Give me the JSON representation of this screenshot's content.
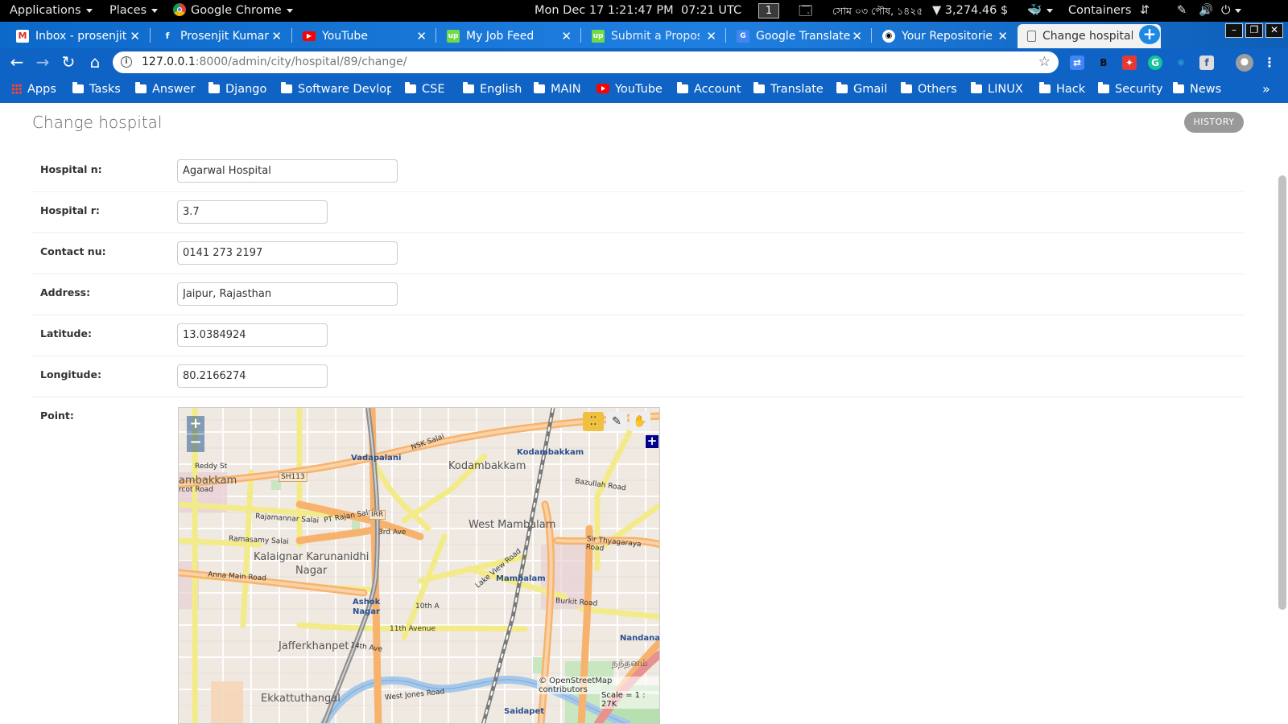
{
  "topbar": {
    "applications": "Applications",
    "places": "Places",
    "chrome": "Google Chrome",
    "datetime": "Mon Dec 17  1:21:47 PM",
    "utc": "07:21 UTC",
    "workspace": "1",
    "bengali_date": "সোম ০৩ পৌষ, ১৪২৫",
    "price": "▼ 3,274.46 $",
    "containers": "Containers"
  },
  "tabs": [
    {
      "label": "Inbox - prosenjit",
      "icon": "gmail-icon",
      "color": "#ffffff"
    },
    {
      "label": "Prosenjit Kumar",
      "icon": "facebook-icon",
      "color": "#3b5998"
    },
    {
      "label": "YouTube",
      "icon": "youtube-icon",
      "color": "#ff0000"
    },
    {
      "label": "My Job Feed",
      "icon": "upwork-icon",
      "color": "#6fda44"
    },
    {
      "label": "Submit a Propos",
      "icon": "upwork-icon",
      "color": "#6fda44"
    },
    {
      "label": "Google Translate",
      "icon": "translate-icon",
      "color": "#4285f4"
    },
    {
      "label": "Your Repositorie",
      "icon": "github-icon",
      "color": "#000000"
    },
    {
      "label": "Change hospital",
      "icon": "document-icon",
      "color": "#ffffff"
    }
  ],
  "omnibox": {
    "host": "127.0.0.1",
    "path": ":8000/admin/city/hospital/89/change/"
  },
  "bookmarks": [
    {
      "label": "Apps",
      "icon": "apps-icon"
    },
    {
      "label": "Tasks",
      "icon": "folder-icon"
    },
    {
      "label": "Answer",
      "icon": "folder-icon"
    },
    {
      "label": "Django",
      "icon": "folder-icon"
    },
    {
      "label": "Software Devlop",
      "icon": "folder-icon"
    },
    {
      "label": "CSE",
      "icon": "folder-icon"
    },
    {
      "label": "English",
      "icon": "folder-icon"
    },
    {
      "label": "MAIN",
      "icon": "folder-icon"
    },
    {
      "label": "YouTube",
      "icon": "youtube-icon"
    },
    {
      "label": "Account",
      "icon": "folder-icon"
    },
    {
      "label": "Translate",
      "icon": "folder-icon"
    },
    {
      "label": "Gmail",
      "icon": "folder-icon"
    },
    {
      "label": "Others",
      "icon": "folder-icon"
    },
    {
      "label": "LINUX",
      "icon": "folder-icon"
    },
    {
      "label": "Hack",
      "icon": "folder-icon"
    },
    {
      "label": "Security",
      "icon": "folder-icon"
    },
    {
      "label": "News",
      "icon": "folder-icon"
    }
  ],
  "page": {
    "title": "Change hospital",
    "history_label": "HISTORY"
  },
  "form": {
    "hospital_name": {
      "label": "Hospital n:",
      "value": "Agarwal Hospital"
    },
    "hospital_rating": {
      "label": "Hospital r:",
      "value": "3.7"
    },
    "contact": {
      "label": "Contact nu:",
      "value": "0141 273 2197"
    },
    "address": {
      "label": "Address:",
      "value": "Jaipur, Rajasthan"
    },
    "latitude": {
      "label": "Latitude:",
      "value": "13.0384924"
    },
    "longitude": {
      "label": "Longitude:",
      "value": "80.2166274"
    },
    "point": {
      "label": "Point:"
    }
  },
  "map": {
    "attribution": "© OpenStreetMap contributors",
    "scale": "Scale = 1 : 27K",
    "labels": [
      "Vadapalani",
      "NSK Salai",
      "Kodambakkam",
      "Kodambakkam",
      "Reddy St",
      "ambakkam",
      "SH113",
      "rcot Road",
      "Rajamannar Salai",
      "PT Rajan Salai",
      "IRR",
      "Bazullah Road",
      "West Mambalam",
      "3rd Ave",
      "Ramasamy Salai",
      "Kalaignar Karunanidhi",
      "Nagar",
      "Sir Thyagaraya Road",
      "Anna Main Road",
      "Mambalam",
      "Lake View Road",
      "Burkit Road",
      "Ashok",
      "Nagar",
      "11th Avenue",
      "10th A",
      "Jafferkhanpet",
      "14th Ave",
      "Nandana",
      "Ekkattuthangal",
      "West Jones Road",
      "Saidapet",
      "நந்தனம்"
    ]
  }
}
